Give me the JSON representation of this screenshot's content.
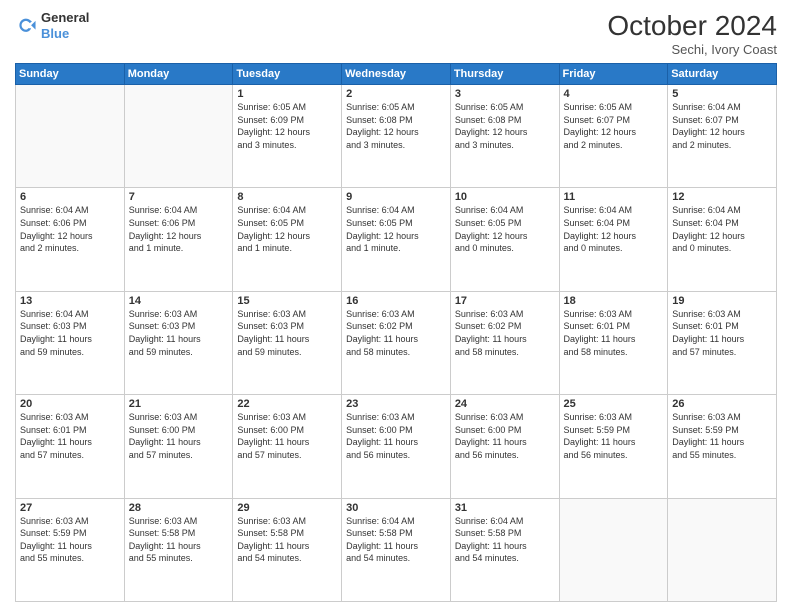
{
  "logo": {
    "line1": "General",
    "line2": "Blue"
  },
  "title": "October 2024",
  "subtitle": "Sechi, Ivory Coast",
  "weekdays": [
    "Sunday",
    "Monday",
    "Tuesday",
    "Wednesday",
    "Thursday",
    "Friday",
    "Saturday"
  ],
  "weeks": [
    [
      {
        "day": "",
        "info": ""
      },
      {
        "day": "",
        "info": ""
      },
      {
        "day": "1",
        "info": "Sunrise: 6:05 AM\nSunset: 6:09 PM\nDaylight: 12 hours\nand 3 minutes."
      },
      {
        "day": "2",
        "info": "Sunrise: 6:05 AM\nSunset: 6:08 PM\nDaylight: 12 hours\nand 3 minutes."
      },
      {
        "day": "3",
        "info": "Sunrise: 6:05 AM\nSunset: 6:08 PM\nDaylight: 12 hours\nand 3 minutes."
      },
      {
        "day": "4",
        "info": "Sunrise: 6:05 AM\nSunset: 6:07 PM\nDaylight: 12 hours\nand 2 minutes."
      },
      {
        "day": "5",
        "info": "Sunrise: 6:04 AM\nSunset: 6:07 PM\nDaylight: 12 hours\nand 2 minutes."
      }
    ],
    [
      {
        "day": "6",
        "info": "Sunrise: 6:04 AM\nSunset: 6:06 PM\nDaylight: 12 hours\nand 2 minutes."
      },
      {
        "day": "7",
        "info": "Sunrise: 6:04 AM\nSunset: 6:06 PM\nDaylight: 12 hours\nand 1 minute."
      },
      {
        "day": "8",
        "info": "Sunrise: 6:04 AM\nSunset: 6:05 PM\nDaylight: 12 hours\nand 1 minute."
      },
      {
        "day": "9",
        "info": "Sunrise: 6:04 AM\nSunset: 6:05 PM\nDaylight: 12 hours\nand 1 minute."
      },
      {
        "day": "10",
        "info": "Sunrise: 6:04 AM\nSunset: 6:05 PM\nDaylight: 12 hours\nand 0 minutes."
      },
      {
        "day": "11",
        "info": "Sunrise: 6:04 AM\nSunset: 6:04 PM\nDaylight: 12 hours\nand 0 minutes."
      },
      {
        "day": "12",
        "info": "Sunrise: 6:04 AM\nSunset: 6:04 PM\nDaylight: 12 hours\nand 0 minutes."
      }
    ],
    [
      {
        "day": "13",
        "info": "Sunrise: 6:04 AM\nSunset: 6:03 PM\nDaylight: 11 hours\nand 59 minutes."
      },
      {
        "day": "14",
        "info": "Sunrise: 6:03 AM\nSunset: 6:03 PM\nDaylight: 11 hours\nand 59 minutes."
      },
      {
        "day": "15",
        "info": "Sunrise: 6:03 AM\nSunset: 6:03 PM\nDaylight: 11 hours\nand 59 minutes."
      },
      {
        "day": "16",
        "info": "Sunrise: 6:03 AM\nSunset: 6:02 PM\nDaylight: 11 hours\nand 58 minutes."
      },
      {
        "day": "17",
        "info": "Sunrise: 6:03 AM\nSunset: 6:02 PM\nDaylight: 11 hours\nand 58 minutes."
      },
      {
        "day": "18",
        "info": "Sunrise: 6:03 AM\nSunset: 6:01 PM\nDaylight: 11 hours\nand 58 minutes."
      },
      {
        "day": "19",
        "info": "Sunrise: 6:03 AM\nSunset: 6:01 PM\nDaylight: 11 hours\nand 57 minutes."
      }
    ],
    [
      {
        "day": "20",
        "info": "Sunrise: 6:03 AM\nSunset: 6:01 PM\nDaylight: 11 hours\nand 57 minutes."
      },
      {
        "day": "21",
        "info": "Sunrise: 6:03 AM\nSunset: 6:00 PM\nDaylight: 11 hours\nand 57 minutes."
      },
      {
        "day": "22",
        "info": "Sunrise: 6:03 AM\nSunset: 6:00 PM\nDaylight: 11 hours\nand 57 minutes."
      },
      {
        "day": "23",
        "info": "Sunrise: 6:03 AM\nSunset: 6:00 PM\nDaylight: 11 hours\nand 56 minutes."
      },
      {
        "day": "24",
        "info": "Sunrise: 6:03 AM\nSunset: 6:00 PM\nDaylight: 11 hours\nand 56 minutes."
      },
      {
        "day": "25",
        "info": "Sunrise: 6:03 AM\nSunset: 5:59 PM\nDaylight: 11 hours\nand 56 minutes."
      },
      {
        "day": "26",
        "info": "Sunrise: 6:03 AM\nSunset: 5:59 PM\nDaylight: 11 hours\nand 55 minutes."
      }
    ],
    [
      {
        "day": "27",
        "info": "Sunrise: 6:03 AM\nSunset: 5:59 PM\nDaylight: 11 hours\nand 55 minutes."
      },
      {
        "day": "28",
        "info": "Sunrise: 6:03 AM\nSunset: 5:58 PM\nDaylight: 11 hours\nand 55 minutes."
      },
      {
        "day": "29",
        "info": "Sunrise: 6:03 AM\nSunset: 5:58 PM\nDaylight: 11 hours\nand 54 minutes."
      },
      {
        "day": "30",
        "info": "Sunrise: 6:04 AM\nSunset: 5:58 PM\nDaylight: 11 hours\nand 54 minutes."
      },
      {
        "day": "31",
        "info": "Sunrise: 6:04 AM\nSunset: 5:58 PM\nDaylight: 11 hours\nand 54 minutes."
      },
      {
        "day": "",
        "info": ""
      },
      {
        "day": "",
        "info": ""
      }
    ]
  ]
}
